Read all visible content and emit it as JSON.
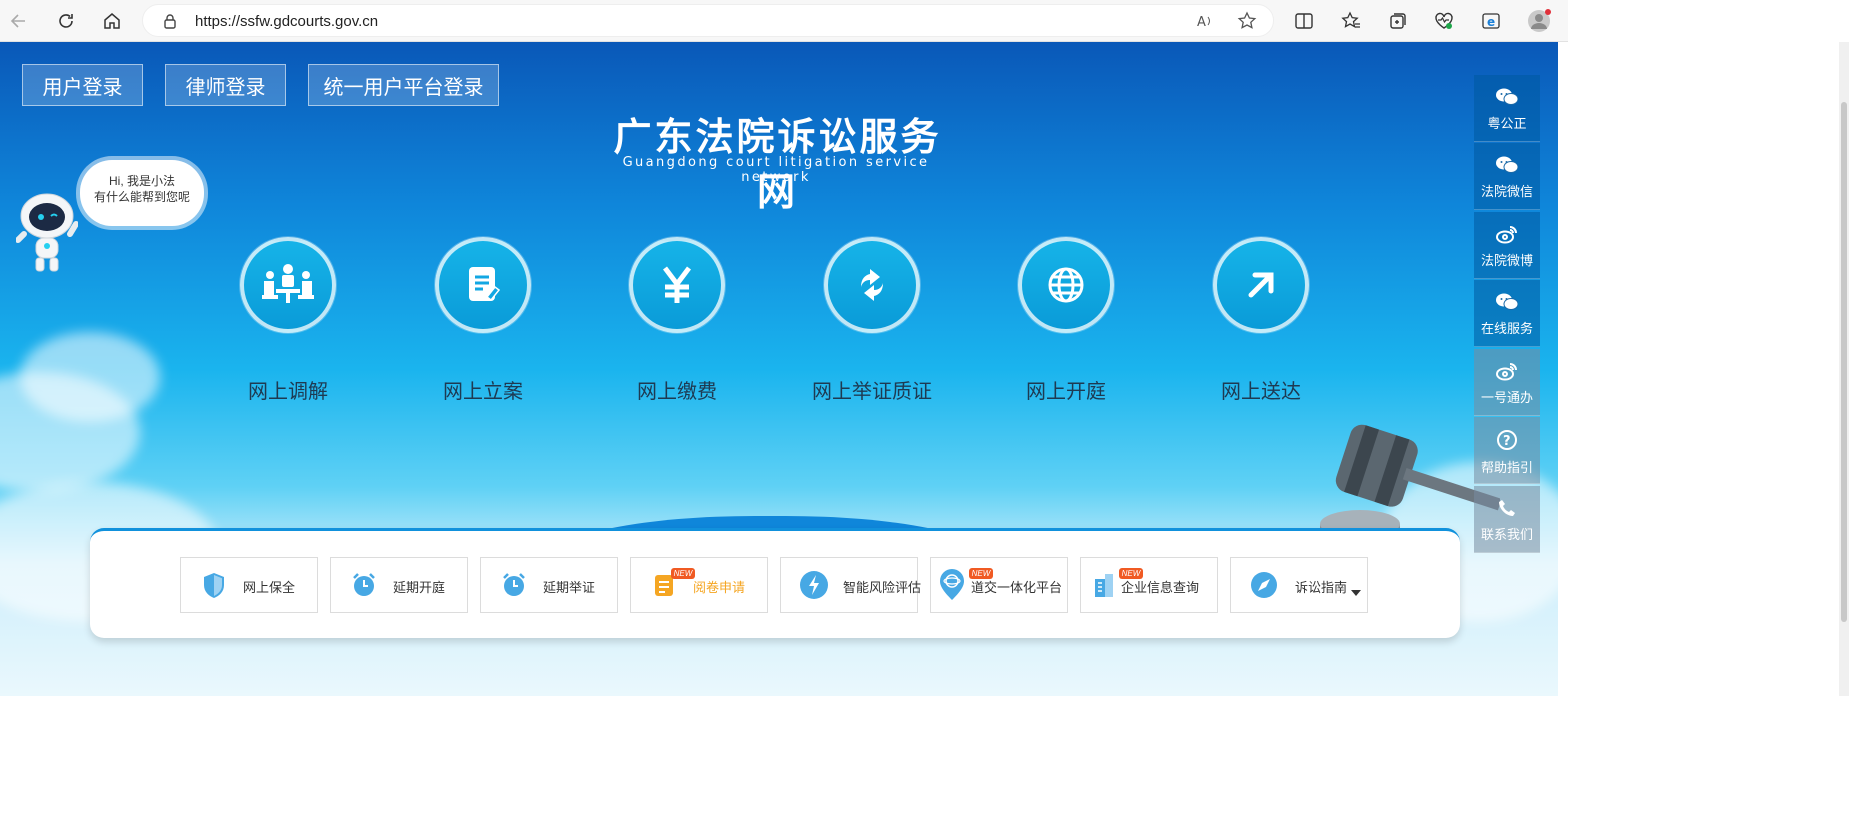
{
  "browser": {
    "url": "https://ssfw.gdcourts.gov.cn",
    "back_icon": "back-arrow-icon",
    "refresh_icon": "refresh-icon",
    "home_icon": "home-icon"
  },
  "login_buttons": [
    {
      "label": "用户登录"
    },
    {
      "label": "律师登录"
    },
    {
      "label": "统一用户平台登录"
    }
  ],
  "header": {
    "title_cn": "广东法院诉讼服务网",
    "title_en": "Guangdong court litigation service network"
  },
  "assistant": {
    "line1": "Hi, 我是小法",
    "line2": "有什么能帮到您呢"
  },
  "services": [
    {
      "label": "网上调解",
      "icon": "people-meeting-icon"
    },
    {
      "label": "网上立案",
      "icon": "document-edit-icon"
    },
    {
      "label": "网上缴费",
      "icon": "yuan-icon"
    },
    {
      "label": "网上举证质证",
      "icon": "refresh-arrows-icon"
    },
    {
      "label": "网上开庭",
      "icon": "globe-icon"
    },
    {
      "label": "网上送达",
      "icon": "arrow-up-right-icon"
    }
  ],
  "floatbar": [
    {
      "label": "粤公正",
      "icon": "wechat-icon"
    },
    {
      "label": "法院微信",
      "icon": "wechat-icon"
    },
    {
      "label": "法院微博",
      "icon": "weibo-icon"
    },
    {
      "label": "在线服务",
      "icon": "wechat-icon"
    },
    {
      "label": "一号通办",
      "icon": "weibo-icon"
    },
    {
      "label": "帮助指引",
      "icon": "question-icon"
    },
    {
      "label": "联系我们",
      "icon": "phone-icon"
    }
  ],
  "quick_links": [
    {
      "label": "网上保全",
      "icon": "shield-icon",
      "is_new": false,
      "highlight": false
    },
    {
      "label": "延期开庭",
      "icon": "alarm-clock-icon",
      "is_new": false,
      "highlight": false
    },
    {
      "label": "延期举证",
      "icon": "alarm-clock-icon",
      "is_new": false,
      "highlight": false
    },
    {
      "label": "阅卷申请",
      "icon": "checklist-icon",
      "is_new": true,
      "highlight": true
    },
    {
      "label": "智能风险评估",
      "icon": "lightning-icon",
      "is_new": false,
      "highlight": false
    },
    {
      "label": "道交一体化平台",
      "icon": "atom-pin-icon",
      "is_new": true,
      "highlight": false
    },
    {
      "label": "企业信息查询",
      "icon": "building-icon",
      "is_new": true,
      "highlight": false
    },
    {
      "label": "诉讼指南",
      "icon": "compass-icon",
      "is_new": false,
      "highlight": false,
      "has_dropdown": true
    }
  ],
  "new_badge_text": "NEW",
  "colors": {
    "accent": "#1191dc",
    "highlight": "#f5a623",
    "badge": "#f05a23"
  }
}
